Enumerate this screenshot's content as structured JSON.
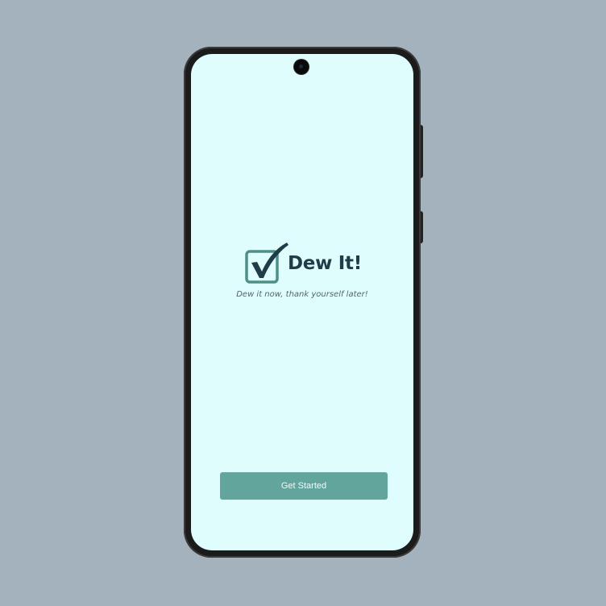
{
  "app": {
    "title": "Dew It!",
    "tagline": "Dew it now, thank yourself later!"
  },
  "actions": {
    "get_started_label": "Get Started"
  },
  "icons": {
    "logo": "checkbox-check-icon",
    "camera": "front-camera"
  },
  "colors": {
    "page_background": "#a3b2bc",
    "screen_background": "#dffdfd",
    "brand_dark": "#1f3c48",
    "button": "#62a59d",
    "button_text": "#f2fbfa",
    "logo_box": "#4f8f86"
  }
}
